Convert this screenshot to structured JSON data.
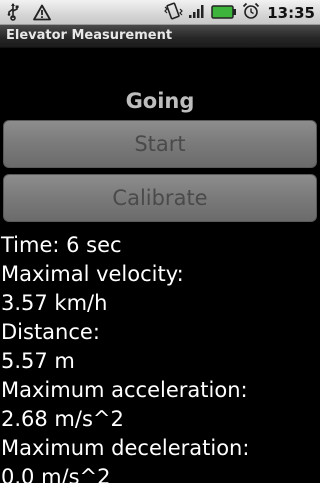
{
  "status_bar": {
    "time": "13:35",
    "icons": [
      "usb-icon",
      "warning-icon",
      "vibrate-icon",
      "signal-icon",
      "battery-icon",
      "alarm-icon"
    ]
  },
  "app": {
    "title": "Elevator Measurement"
  },
  "state_label": "Going",
  "buttons": {
    "start_label": "Start",
    "calibrate_label": "Calibrate"
  },
  "measurements": {
    "time": "Time: 6 sec",
    "max_velocity_label": "Maximal velocity:",
    "max_velocity_value": "3.57 km/h",
    "distance_label": "Distance:",
    "distance_value": "5.57 m",
    "max_accel_label": "Maximum acceleration:",
    "max_accel_value": "2.68 m/s^2",
    "max_decel_label": "Maximum deceleration:",
    "max_decel_value": "0.0 m/s^2"
  },
  "colors": {
    "background": "#000000",
    "statusbar": "#d6d6d6",
    "titlebar": "#262626",
    "button": "#7a7a7a",
    "button_text_disabled": "#4a4a4a",
    "battery_green": "#3db53d"
  }
}
